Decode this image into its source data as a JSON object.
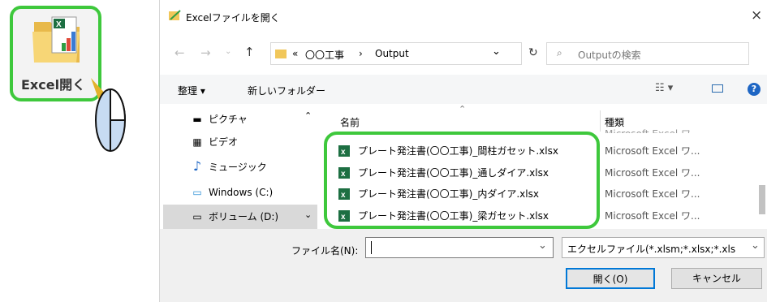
{
  "excel_button": {
    "label": "Excel開く",
    "icon": "excel-folder-icon"
  },
  "dialog": {
    "title": "Excelファイルを開く",
    "close_label": "×",
    "address": {
      "prefix": "«",
      "folder_parent": "〇〇工事",
      "separator": "›",
      "folder_current": "Output"
    },
    "search_placeholder": "Outputの検索",
    "toolbar": {
      "organize": "整理 ▾",
      "new_folder": "新しいフォルダー"
    },
    "nav_items": [
      {
        "label": "ピクチャ",
        "icon": "pictures-icon"
      },
      {
        "label": "ビデオ",
        "icon": "videos-icon"
      },
      {
        "label": "ミュージック",
        "icon": "music-icon"
      },
      {
        "label": "Windows (C:)",
        "icon": "drive-c-icon"
      },
      {
        "label": "ボリューム (D:)",
        "icon": "drive-d-icon",
        "selected": true
      }
    ],
    "columns": {
      "name": "名前",
      "type": "種類"
    },
    "partial_row_type": "Microsoft Excel ワ...",
    "files": [
      {
        "name": "プレート発注書(〇〇工事)_間柱ガセット.xlsx",
        "type": "Microsoft Excel ワ..."
      },
      {
        "name": "プレート発注書(〇〇工事)_通しダイア.xlsx",
        "type": "Microsoft Excel ワ..."
      },
      {
        "name": "プレート発注書(〇〇工事)_内ダイア.xlsx",
        "type": "Microsoft Excel ワ..."
      },
      {
        "name": "プレート発注書(〇〇工事)_梁ガセット.xlsx",
        "type": "Microsoft Excel ワ..."
      }
    ],
    "filename_label": "ファイル名(N):",
    "filename_value": "",
    "filetype_value": "エクセルファイル(*.xlsm;*.xlsx;*.xls",
    "open_button": "開く(O)",
    "cancel_button": "キャンセル"
  },
  "colors": {
    "highlight": "#3ec83c",
    "accent": "#0078d7",
    "excel_green": "#1d6f42"
  }
}
